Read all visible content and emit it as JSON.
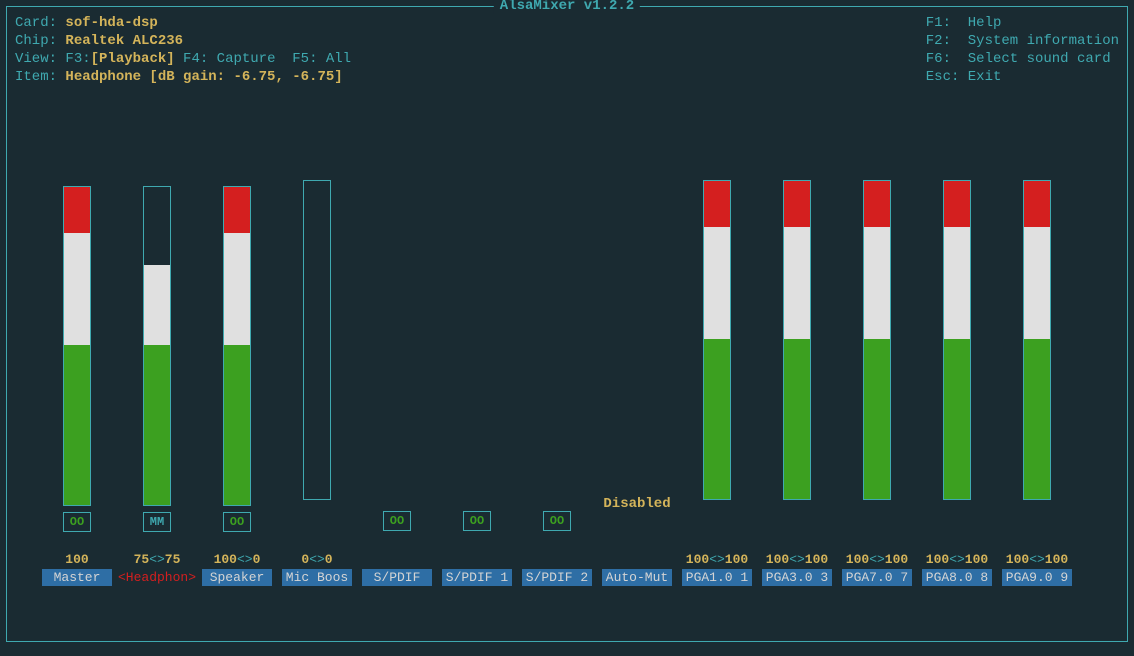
{
  "title": "AlsaMixer v1.2.2",
  "info": {
    "card_label": "Card: ",
    "card_value": "sof-hda-dsp",
    "chip_label": "Chip: ",
    "chip_value": "Realtek ALC236",
    "view_label": "View: ",
    "view_f3": "F3:",
    "view_playback": "[Playback]",
    "view_f4": " F4: Capture ",
    "view_f5": " F5: All",
    "item_label": "Item: ",
    "item_value": "Headphone [dB gain: -6.75, -6.75]"
  },
  "help": {
    "f1_key": "F1: ",
    "f1_text": "Help",
    "f2_key": "F2: ",
    "f2_text": "System information",
    "f6_key": "F6: ",
    "f6_text": "Select sound card",
    "esc_key": "Esc: ",
    "esc_text": "Exit"
  },
  "disabled_text": "Disabled",
  "channels": [
    {
      "name": "Master",
      "label": "Master",
      "selected": false,
      "has_bar": true,
      "bar_pct": 100,
      "mute": "OO",
      "vol_l": "100",
      "vol_r": null,
      "show_disabled": false
    },
    {
      "name": "Headphone",
      "label": "<Headphon>",
      "selected": true,
      "has_bar": true,
      "bar_pct": 75,
      "mute": "MM",
      "vol_l": "75",
      "vol_r": "75",
      "show_disabled": false
    },
    {
      "name": "Speaker",
      "label": "Speaker",
      "selected": false,
      "has_bar": true,
      "bar_pct": 100,
      "mute": "OO",
      "vol_l": "100",
      "vol_r": "0",
      "show_disabled": false
    },
    {
      "name": "Mic-Boost",
      "label": "Mic Boos",
      "selected": false,
      "has_bar": true,
      "bar_pct": 0,
      "mute": null,
      "vol_l": "0",
      "vol_r": "0",
      "show_disabled": false
    },
    {
      "name": "SPDIF",
      "label": "S/PDIF",
      "selected": false,
      "has_bar": false,
      "bar_pct": 0,
      "mute": "OO",
      "vol_l": null,
      "vol_r": null,
      "show_disabled": false
    },
    {
      "name": "SPDIF-1",
      "label": "S/PDIF 1",
      "selected": false,
      "has_bar": false,
      "bar_pct": 0,
      "mute": "OO",
      "vol_l": null,
      "vol_r": null,
      "show_disabled": false
    },
    {
      "name": "SPDIF-2",
      "label": "S/PDIF 2",
      "selected": false,
      "has_bar": false,
      "bar_pct": 0,
      "mute": "OO",
      "vol_l": null,
      "vol_r": null,
      "show_disabled": false
    },
    {
      "name": "Auto-Mute",
      "label": "Auto-Mut",
      "selected": false,
      "has_bar": false,
      "bar_pct": 0,
      "mute": null,
      "vol_l": null,
      "vol_r": null,
      "show_disabled": true
    },
    {
      "name": "PGA1.0",
      "label": "PGA1.0 1",
      "selected": false,
      "has_bar": true,
      "bar_pct": 100,
      "mute": null,
      "vol_l": "100",
      "vol_r": "100",
      "show_disabled": false
    },
    {
      "name": "PGA3.0",
      "label": "PGA3.0 3",
      "selected": false,
      "has_bar": true,
      "bar_pct": 100,
      "mute": null,
      "vol_l": "100",
      "vol_r": "100",
      "show_disabled": false
    },
    {
      "name": "PGA7.0",
      "label": "PGA7.0 7",
      "selected": false,
      "has_bar": true,
      "bar_pct": 100,
      "mute": null,
      "vol_l": "100",
      "vol_r": "100",
      "show_disabled": false
    },
    {
      "name": "PGA8.0",
      "label": "PGA8.0 8",
      "selected": false,
      "has_bar": true,
      "bar_pct": 100,
      "mute": null,
      "vol_l": "100",
      "vol_r": "100",
      "show_disabled": false
    },
    {
      "name": "PGA9.0",
      "label": "PGA9.0 9",
      "selected": false,
      "has_bar": true,
      "bar_pct": 100,
      "mute": null,
      "vol_l": "100",
      "vol_r": "100",
      "show_disabled": false
    }
  ]
}
